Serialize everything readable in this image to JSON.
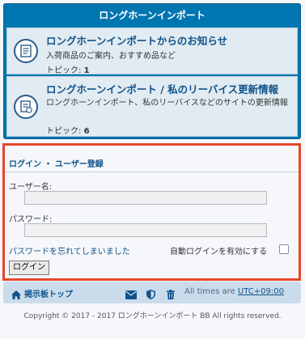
{
  "forum_box": {
    "header": "ロングホーンインポート",
    "forums": [
      {
        "title": "ロングホーンインポートからのお知らせ",
        "description": "入荷商品のご案内、おすすめ品など",
        "topics_label": "トピック:",
        "topics_count": "1",
        "icon": "forum-read-icon"
      },
      {
        "title": "ロングホーンインポート / 私のリーバイス更新情報",
        "description": "ロングホーンインポート、私のリーバイスなどのサイトの更新情報",
        "topics_label": "トピック:",
        "topics_count": "6",
        "icon": "forum-read-icon"
      }
    ]
  },
  "login": {
    "title": "ログイン ・ ユーザー登録",
    "username_label": "ユーザー名:",
    "username_value": "",
    "password_label": "パスワード:",
    "password_value": "",
    "forgot_password": "パスワードを忘れてしまいました",
    "autologin_label": "自動ログインを有効にする",
    "autologin_checked": false,
    "button_label": "ログイン"
  },
  "nav": {
    "board_index": "掲示板トップ",
    "timezone_prefix": "All times are",
    "timezone": "UTC+09:00",
    "icons": [
      "home-icon",
      "mail-icon",
      "shield-icon",
      "trash-icon"
    ]
  },
  "footer": {
    "copyright": "Copyright © 2017 - 2017 ロングホーンインポート BB All rights reserved."
  },
  "colors": {
    "header_blue": "#0076b1",
    "row_bg": "#e1ebf2",
    "link_blue": "#105289",
    "highlight_red": "#e8462e",
    "nav_bg": "#cadceb"
  }
}
